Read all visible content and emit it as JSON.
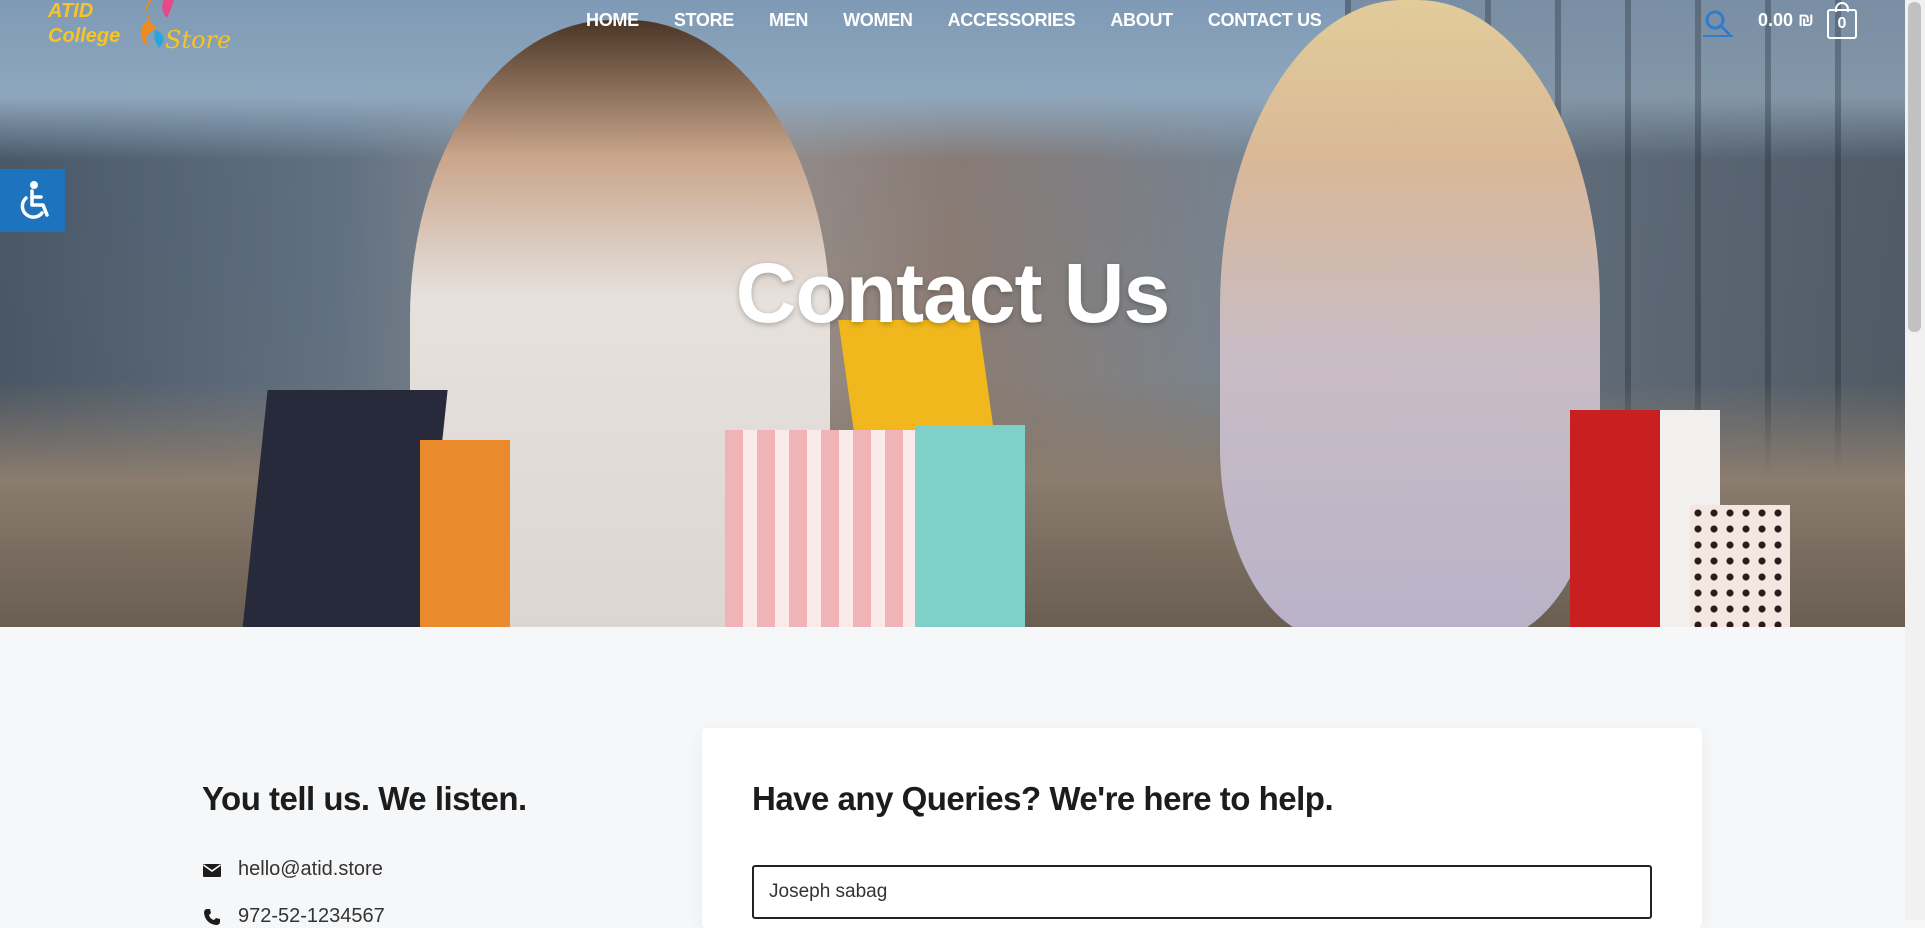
{
  "brand": {
    "line1": "ATID",
    "line2": "College",
    "store": "Store"
  },
  "nav": {
    "items": [
      "HOME",
      "STORE",
      "MEN",
      "WOMEN",
      "ACCESSORIES",
      "ABOUT",
      "CONTACT US"
    ]
  },
  "cart": {
    "total": "0.00 ₪",
    "count": "0"
  },
  "icons": {
    "search": "search-icon",
    "cart": "shopping-bag-icon",
    "accessibility": "wheelchair-icon",
    "email": "envelope-icon",
    "phone": "phone-icon"
  },
  "colors": {
    "accent": "#1e73be",
    "logo": "#f7c423"
  },
  "hero": {
    "title": "Contact Us"
  },
  "contact_info": {
    "heading": "You tell us. We listen.",
    "email": "hello@atid.store",
    "phone": "972-52-1234567"
  },
  "form": {
    "heading": "Have any Queries? We're here to help.",
    "name_value": "Joseph sabag"
  }
}
